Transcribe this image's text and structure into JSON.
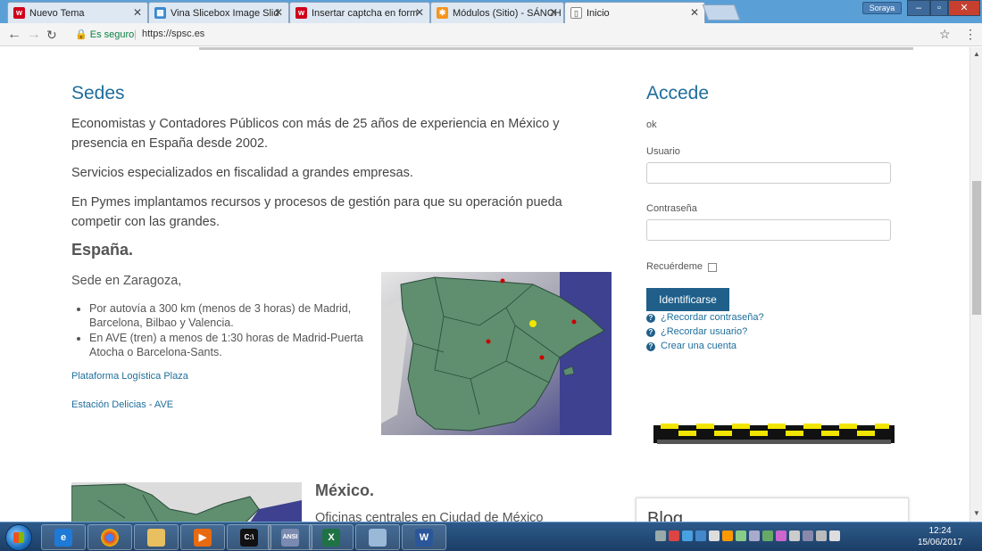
{
  "browser": {
    "tabs": [
      {
        "title": "Nuevo Tema",
        "icon": "w-icon",
        "color": "#d0021b"
      },
      {
        "title": "Vina Slicebox Image Slid",
        "icon": "slicebox-icon",
        "color": "#3a8ad0"
      },
      {
        "title": "Insertar captcha en form",
        "icon": "w-icon",
        "color": "#d0021b"
      },
      {
        "title": "Módulos (Sitio) - SÁNCH",
        "icon": "joomla-icon",
        "color": "#f7941d"
      },
      {
        "title": "Inicio",
        "icon": "page-icon",
        "color": "#888888"
      }
    ],
    "user": "Soraya",
    "secure_label": "Es seguro",
    "url": "https://spsc.es"
  },
  "main": {
    "sedes_title": "Sedes",
    "intro": "Economistas y Contadores Públicos con más de 25 años de experiencia en México y presencia en España desde 2002.",
    "services": "Servicios especializados en fiscalidad a grandes empresas.",
    "pymes": "En Pymes implantamos recursos y procesos de gestión para que su operación pueda competir con las grandes.",
    "espana_title": "España.",
    "sede": "Sede en Zaragoza,",
    "bullets": [
      "Por autovía a 300 km (menos de 3 horas) de Madrid, Barcelona, Bilbao y Valencia.",
      "En AVE (tren) a menos de 1:30 horas de Madrid-Puerta Atocha o Barcelona-Sants."
    ],
    "link1": "Plataforma Logística Plaza",
    "link2": "Estación Delicias - AVE",
    "mexico_title": "México.",
    "mexico_text": "Oficinas centrales en Ciudad de México"
  },
  "sidebar": {
    "accede_title": "Accede",
    "ok": "ok",
    "usuario_label": "Usuario",
    "password_label": "Contraseña",
    "remember_label": "Recuérdeme",
    "login_button": "Identificarse",
    "links": [
      "¿Recordar contraseña?",
      "¿Recordar usuario?",
      "Crear una cuenta"
    ],
    "blog_title": "Blog"
  },
  "taskbar": {
    "time": "12:24",
    "date": "15/06/2017"
  }
}
